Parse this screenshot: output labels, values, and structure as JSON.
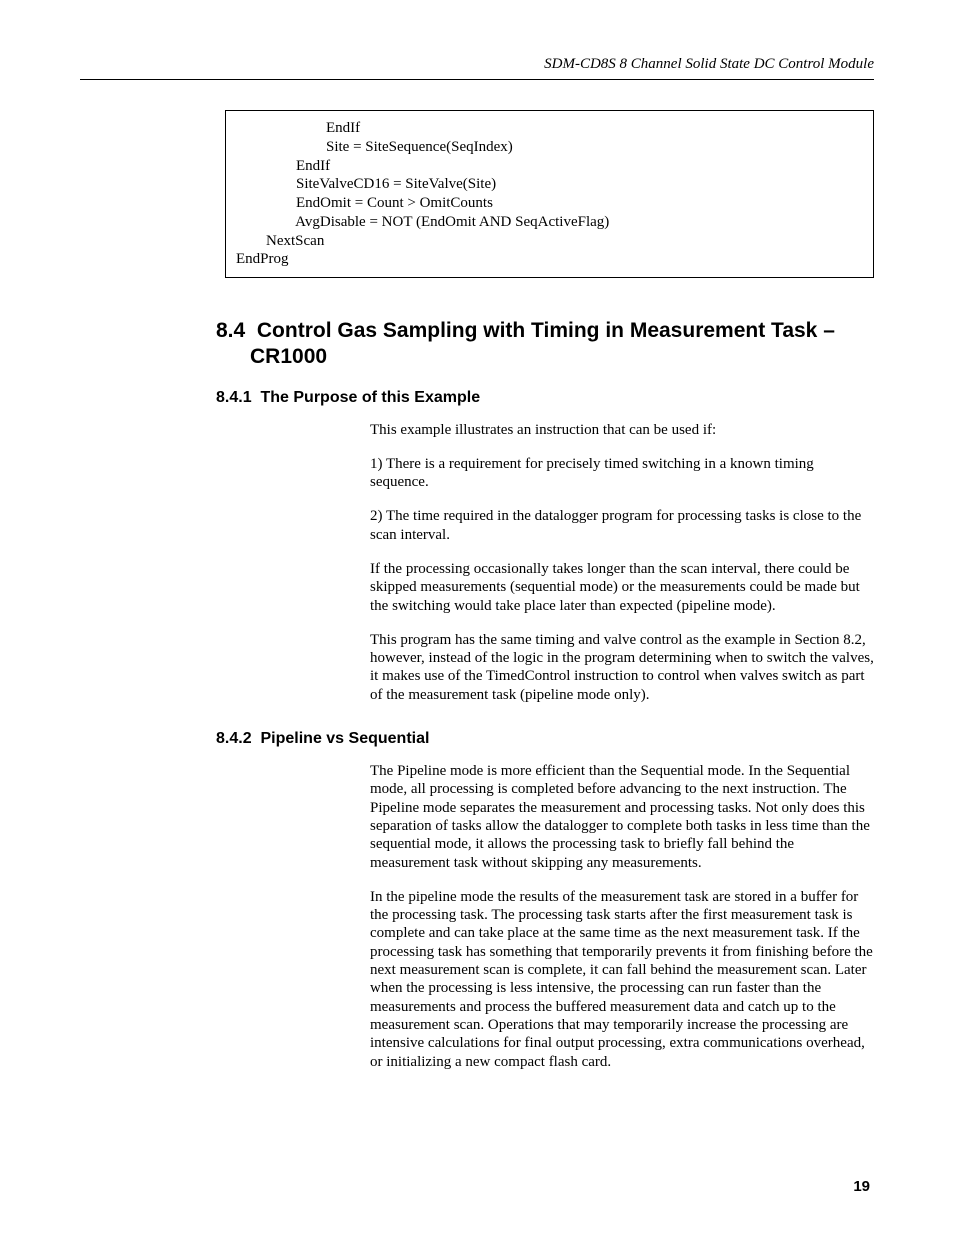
{
  "header": {
    "title": "SDM-CD8S 8 Channel Solid State DC Control Module"
  },
  "code": {
    "lines": "                        EndIf\n                        Site = SiteSequence(SeqIndex)\n                EndIf\n                SiteValveCD16 = SiteValve(Site)\n                EndOmit = Count > OmitCounts\n                AvgDisable = NOT (EndOmit AND SeqActiveFlag)\n        NextScan\nEndProg"
  },
  "section": {
    "number": "8.4",
    "title": "Control Gas Sampling with Timing in Measurement Task – CR1000"
  },
  "sub1": {
    "number": "8.4.1",
    "title": "The Purpose of this Example",
    "p1": "This example illustrates an instruction that can be used if:",
    "p2": "1) There is a requirement for precisely timed switching in a known timing sequence.",
    "p3": "2) The time required in the datalogger program for processing tasks is close to the scan interval.",
    "p4": "If the processing occasionally takes longer than the scan interval, there could be skipped measurements (sequential mode) or the measurements could be made but the switching would take place later than expected (pipeline mode).",
    "p5": "This program has the same timing and valve control as the example in Section 8.2, however, instead of the logic in the program determining when to switch the valves, it makes use of the TimedControl instruction to control when valves switch as part of the measurement task (pipeline mode only)."
  },
  "sub2": {
    "number": "8.4.2",
    "title": "Pipeline vs Sequential",
    "p1": "The Pipeline mode is more efficient than the Sequential mode.  In the Sequential mode, all processing is completed before advancing to the next instruction.  The Pipeline mode separates the measurement and processing tasks.  Not only does this separation of tasks allow the datalogger to complete both tasks in less time than the sequential mode, it allows the processing task to briefly fall behind the measurement task without skipping any measurements.",
    "p2": "In the pipeline mode the results of the measurement task are stored in a buffer for the processing task.  The processing task starts after the first measurement task is complete and can take place at the same time as the next measurement task.  If the processing task has something that temporarily prevents it from finishing before the next measurement scan is complete, it can fall behind the measurement scan.  Later when the processing is less intensive, the processing can run faster than the measurements and process the buffered measurement data and catch up to the measurement scan.  Operations that may temporarily increase the processing are intensive calculations for final output processing, extra communications overhead, or initializing a new compact flash card."
  },
  "pageNumber": "19"
}
